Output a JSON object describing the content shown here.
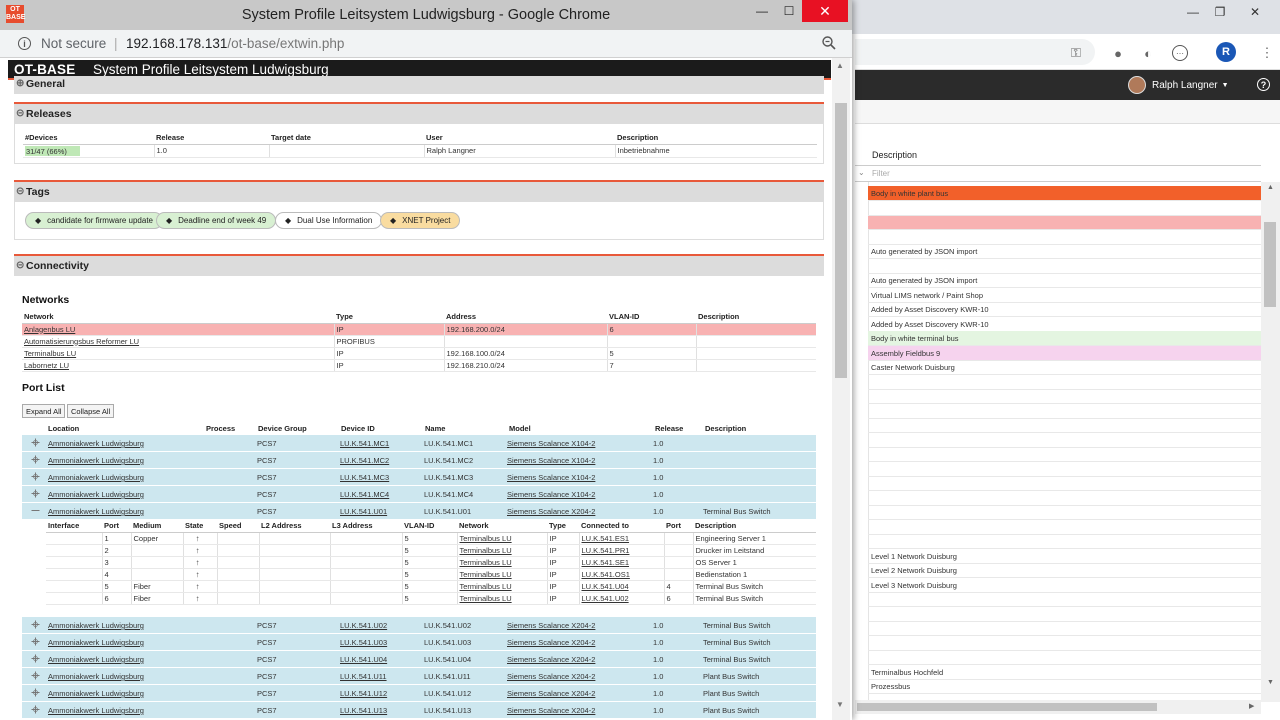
{
  "bg": {
    "user_name": "Ralph Langner",
    "avatar_initial": "R",
    "description_header": "Description",
    "filter_placeholder": "Filter",
    "rows": [
      {
        "text": "Body in white plant bus",
        "color": "#f2602a"
      },
      {
        "text": "",
        "color": "#f8b2b2"
      },
      {
        "text": "Auto generated by JSON import",
        "color": ""
      },
      {
        "text": "Auto generated by JSON import",
        "color": ""
      },
      {
        "text": "Virtual LIMS network / Paint Shop",
        "color": ""
      },
      {
        "text": "Added by Asset Discovery KWR-10",
        "color": ""
      },
      {
        "text": "Added by Asset Discovery KWR-10",
        "color": ""
      },
      {
        "text": "Body in white terminal bus",
        "color": "#e4f5e1"
      },
      {
        "text": "Assembly Fieldbus 9",
        "color": "#f6d3ee"
      },
      {
        "text": "Caster Network Duisburg",
        "color": ""
      },
      {
        "text": "Level 1 Network Duisburg",
        "color": ""
      },
      {
        "text": "Level 2 Network Duisburg",
        "color": ""
      },
      {
        "text": "Level 3 Network Duisburg",
        "color": ""
      },
      {
        "text": "Terminalbus Hochfeld",
        "color": ""
      },
      {
        "text": "Prozessbus",
        "color": ""
      }
    ]
  },
  "popup": {
    "window_title": "System Profile Leitsystem Ludwigsburg - Google Chrome",
    "logo": "OT BASE",
    "not_secure": "Not secure",
    "url_host": "192.168.178.131",
    "url_path": "/ot-base/extwin.php",
    "brand": "OT-BASE",
    "page_title": "System Profile  Leitsystem Ludwigsburg"
  },
  "sections": {
    "general": "General",
    "releases": "Releases",
    "tags": "Tags",
    "connectivity": "Connectivity"
  },
  "releases": {
    "headers": [
      "#Devices",
      "Release",
      "Target date",
      "User",
      "Description"
    ],
    "row": {
      "devices": "31/47 (66%)",
      "progress": 0.66,
      "release": "1.0",
      "target": "",
      "user": "Ralph Langner",
      "description": "Inbetriebnahme"
    }
  },
  "tags": [
    {
      "label": "candidate for firmware update",
      "bg": "#d8f0d2"
    },
    {
      "label": "Deadline end of week 49",
      "bg": "#d8f0d2"
    },
    {
      "label": "Dual Use Information",
      "bg": "#ffffff"
    },
    {
      "label": "XNET Project",
      "bg": "#f9dca0"
    }
  ],
  "networks": {
    "title": "Networks",
    "headers": [
      "Network",
      "Type",
      "Address",
      "VLAN-ID",
      "Description"
    ],
    "rows": [
      {
        "network": "Anlagenbus LU",
        "type": "IP",
        "address": "192.168.200.0/24",
        "vlan": "6",
        "description": "",
        "highlight": true
      },
      {
        "network": "Automatisierungsbus Reformer LU",
        "type": "PROFIBUS",
        "address": "",
        "vlan": "",
        "description": "",
        "highlight": false
      },
      {
        "network": "Terminalbus LU",
        "type": "IP",
        "address": "192.168.100.0/24",
        "vlan": "5",
        "description": "",
        "highlight": false
      },
      {
        "network": "Labornetz LU",
        "type": "IP",
        "address": "192.168.210.0/24",
        "vlan": "7",
        "description": "",
        "highlight": false
      }
    ]
  },
  "ports": {
    "title": "Port List",
    "expand_all": "Expand All",
    "collapse_all": "Collapse All",
    "headers": [
      "Location",
      "Process",
      "Device Group",
      "Device ID",
      "Name",
      "Model",
      "Release",
      "Description"
    ],
    "devices_top": [
      {
        "location": "Ammoniakwerk Ludwigsburg",
        "group": "PCS7",
        "id": "LU.K.541.MC1",
        "name": "LU.K.541.MC1",
        "model": "Siemens Scalance X104-2",
        "release": "1.0",
        "release_warn": false,
        "description": ""
      },
      {
        "location": "Ammoniakwerk Ludwigsburg",
        "group": "PCS7",
        "id": "LU.K.541.MC2",
        "name": "LU.K.541.MC2",
        "model": "Siemens Scalance X104-2",
        "release": "1.0",
        "release_warn": false,
        "description": ""
      },
      {
        "location": "Ammoniakwerk Ludwigsburg",
        "group": "PCS7",
        "id": "LU.K.541.MC3",
        "name": "LU.K.541.MC3",
        "model": "Siemens Scalance X104-2",
        "release": "1.0",
        "release_warn": false,
        "description": ""
      },
      {
        "location": "Ammoniakwerk Ludwigsburg",
        "group": "PCS7",
        "id": "LU.K.541.MC4",
        "name": "LU.K.541.MC4",
        "model": "Siemens Scalance X104-2",
        "release": "1.0",
        "release_warn": false,
        "description": ""
      }
    ],
    "expanded": {
      "location": "Ammoniakwerk Ludwigsburg",
      "group": "PCS7",
      "id": "LU.K.541.U01",
      "name": "LU.K.541.U01",
      "model": "Siemens Scalance X204-2",
      "release": "1.0",
      "release_warn": true,
      "description": "Terminal Bus Switch"
    },
    "iface_headers": [
      "Interface",
      "Port",
      "Medium",
      "State",
      "Speed",
      "L2 Address",
      "L3 Address",
      "VLAN-ID",
      "Network",
      "Type",
      "Connected to",
      "Port",
      "Description"
    ],
    "interfaces": [
      {
        "port": "1",
        "medium": "Copper",
        "vlan": "5",
        "network": "Terminalbus LU",
        "type": "IP",
        "connected": "LU.K.541.ES1",
        "cport": "",
        "description": "Engineering Server 1"
      },
      {
        "port": "2",
        "medium": "",
        "vlan": "5",
        "network": "Terminalbus LU",
        "type": "IP",
        "connected": "LU.K.541.PR1",
        "cport": "",
        "description": "Drucker im Leitstand"
      },
      {
        "port": "3",
        "medium": "",
        "vlan": "5",
        "network": "Terminalbus LU",
        "type": "IP",
        "connected": "LU.K.541.SE1",
        "cport": "",
        "description": "OS Server 1"
      },
      {
        "port": "4",
        "medium": "",
        "vlan": "5",
        "network": "Terminalbus LU",
        "type": "IP",
        "connected": "LU.K.541.OS1",
        "cport": "",
        "description": "Bedienstation 1"
      },
      {
        "port": "5",
        "medium": "Fiber",
        "vlan": "5",
        "network": "Terminalbus LU",
        "type": "IP",
        "connected": "LU.K.541.U04",
        "cport": "4",
        "description": "Terminal Bus Switch"
      },
      {
        "port": "6",
        "medium": "Fiber",
        "vlan": "5",
        "network": "Terminalbus LU",
        "type": "IP",
        "connected": "LU.K.541.U02",
        "cport": "6",
        "description": "Terminal Bus Switch"
      }
    ],
    "devices_bottom": [
      {
        "location": "Ammoniakwerk Ludwigsburg",
        "group": "PCS7",
        "id": "LU.K.541.U02",
        "name": "LU.K.541.U02",
        "model": "Siemens Scalance X204-2",
        "release": "1.0",
        "release_warn": false,
        "description": "Terminal Bus Switch"
      },
      {
        "location": "Ammoniakwerk Ludwigsburg",
        "group": "PCS7",
        "id": "LU.K.541.U03",
        "name": "LU.K.541.U03",
        "model": "Siemens Scalance X204-2",
        "release": "1.0",
        "release_warn": false,
        "description": "Terminal Bus Switch"
      },
      {
        "location": "Ammoniakwerk Ludwigsburg",
        "group": "PCS7",
        "id": "LU.K.541.U04",
        "name": "LU.K.541.U04",
        "model": "Siemens Scalance X204-2",
        "release": "1.0",
        "release_warn": true,
        "description": "Terminal Bus Switch"
      },
      {
        "location": "Ammoniakwerk Ludwigsburg",
        "group": "PCS7",
        "id": "LU.K.541.U11",
        "name": "LU.K.541.U11",
        "model": "Siemens Scalance X204-2",
        "release": "1.0",
        "release_warn": false,
        "description": "Plant Bus Switch"
      },
      {
        "location": "Ammoniakwerk Ludwigsburg",
        "group": "PCS7",
        "id": "LU.K.541.U12",
        "name": "LU.K.541.U12",
        "model": "Siemens Scalance X204-2",
        "release": "1.0",
        "release_warn": false,
        "description": "Plant Bus Switch"
      },
      {
        "location": "Ammoniakwerk Ludwigsburg",
        "group": "PCS7",
        "id": "LU.K.541.U13",
        "name": "LU.K.541.U13",
        "model": "Siemens Scalance X204-2",
        "release": "1.0",
        "release_warn": false,
        "description": "Plant Bus Switch"
      }
    ]
  },
  "colors": {
    "accent": "#e8593a",
    "row_highlight": "#f8b2b2",
    "device_row": "#cde7ef",
    "close": "#e81123",
    "progress": "#bfe8b6"
  }
}
